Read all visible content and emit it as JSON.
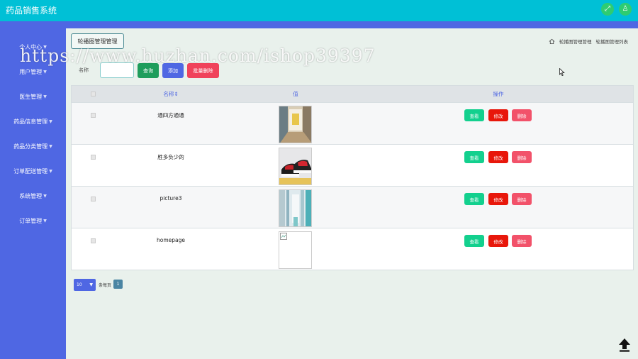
{
  "app": {
    "title": "药品销售系统"
  },
  "header": {
    "tools": [
      "fullscreen-icon",
      "user-icon"
    ]
  },
  "sidebar": {
    "items": [
      {
        "label": "个人中心"
      },
      {
        "label": "用户管理"
      },
      {
        "label": "医生管理"
      },
      {
        "label": "药品信息管理"
      },
      {
        "label": "药品分类管理"
      },
      {
        "label": "订单配送管理"
      },
      {
        "label": "系统管理"
      },
      {
        "label": "订单管理"
      }
    ]
  },
  "page": {
    "title_button": "轮播图管理管理",
    "breadcrumb": [
      "轮播图管理管理",
      "轮播图管理列表"
    ]
  },
  "search": {
    "label": "名称",
    "value": "",
    "query_label": "查询",
    "add_label": "添加",
    "batch_delete_label": "批量删除"
  },
  "watermark": "https://www.huzhan.com/ishop39397",
  "table": {
    "headers": {
      "name": "名称",
      "sort_icon": "sort-icon",
      "value": "值",
      "actions": "操作"
    },
    "rows": [
      {
        "name": "通四方通通",
        "image": "hallway-photo"
      },
      {
        "name": "胜多负少的",
        "image": "sneaker-photo"
      },
      {
        "name": "picture3",
        "image": "corridor-photo"
      },
      {
        "name": "homepage",
        "image": "broken-image"
      }
    ],
    "actions": {
      "view": "查看",
      "edit": "修改",
      "delete": "删除"
    }
  },
  "pagination": {
    "page_size": "10",
    "per_page_label": "条每页",
    "current_page": "1"
  },
  "colors": {
    "header": "#00c0d6",
    "sidebar": "#4f67e3",
    "view": "#13d08e",
    "edit": "#e8170b",
    "delete": "#f2526a"
  }
}
